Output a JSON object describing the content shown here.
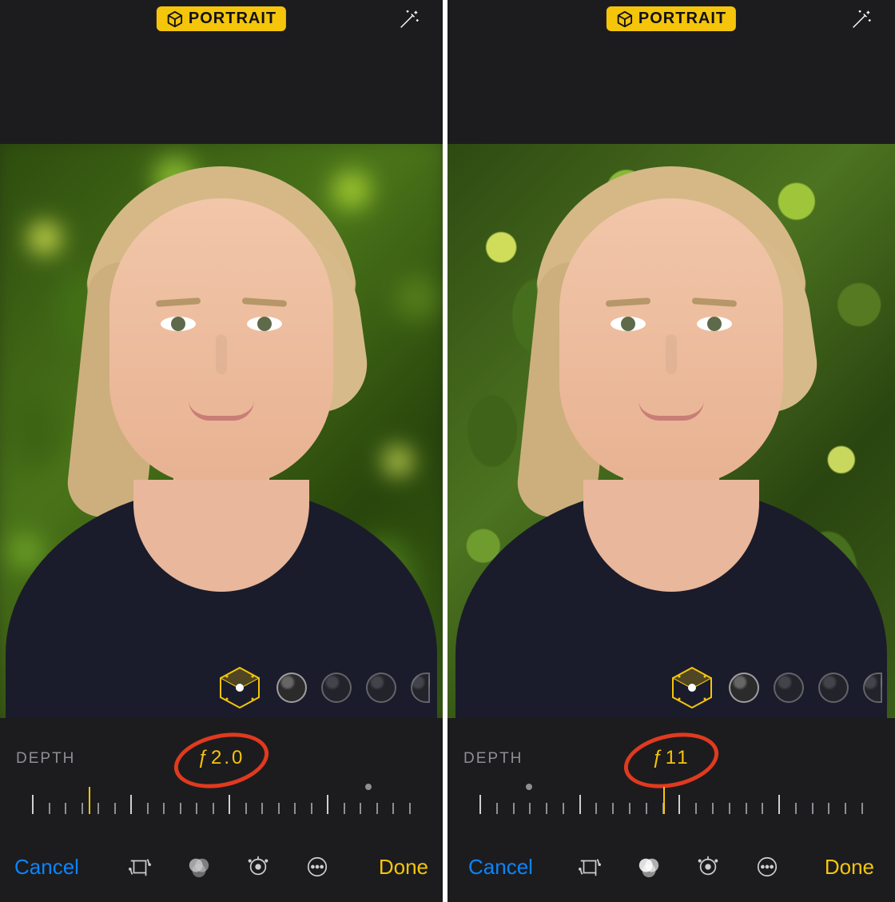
{
  "panes": [
    {
      "mode_badge": "PORTRAIT",
      "depth_label": "DEPTH",
      "f_value": "ƒ2.0",
      "ruler": {
        "dot_pos_pct": 88,
        "cursor_pos_pct": 15,
        "tick_count": 24,
        "tall_every": 6
      },
      "cancel": "Cancel",
      "done": "Done",
      "background_blur": true
    },
    {
      "mode_badge": "PORTRAIT",
      "depth_label": "DEPTH",
      "f_value": "ƒ11",
      "ruler": {
        "dot_pos_pct": 12,
        "cursor_pos_pct": 48,
        "tick_count": 24,
        "tall_every": 6
      },
      "cancel": "Cancel",
      "done": "Done",
      "background_blur": false
    }
  ],
  "lighting_options": [
    "natural-light",
    "studio-light",
    "contour-light",
    "stage-light",
    "stage-mono"
  ]
}
